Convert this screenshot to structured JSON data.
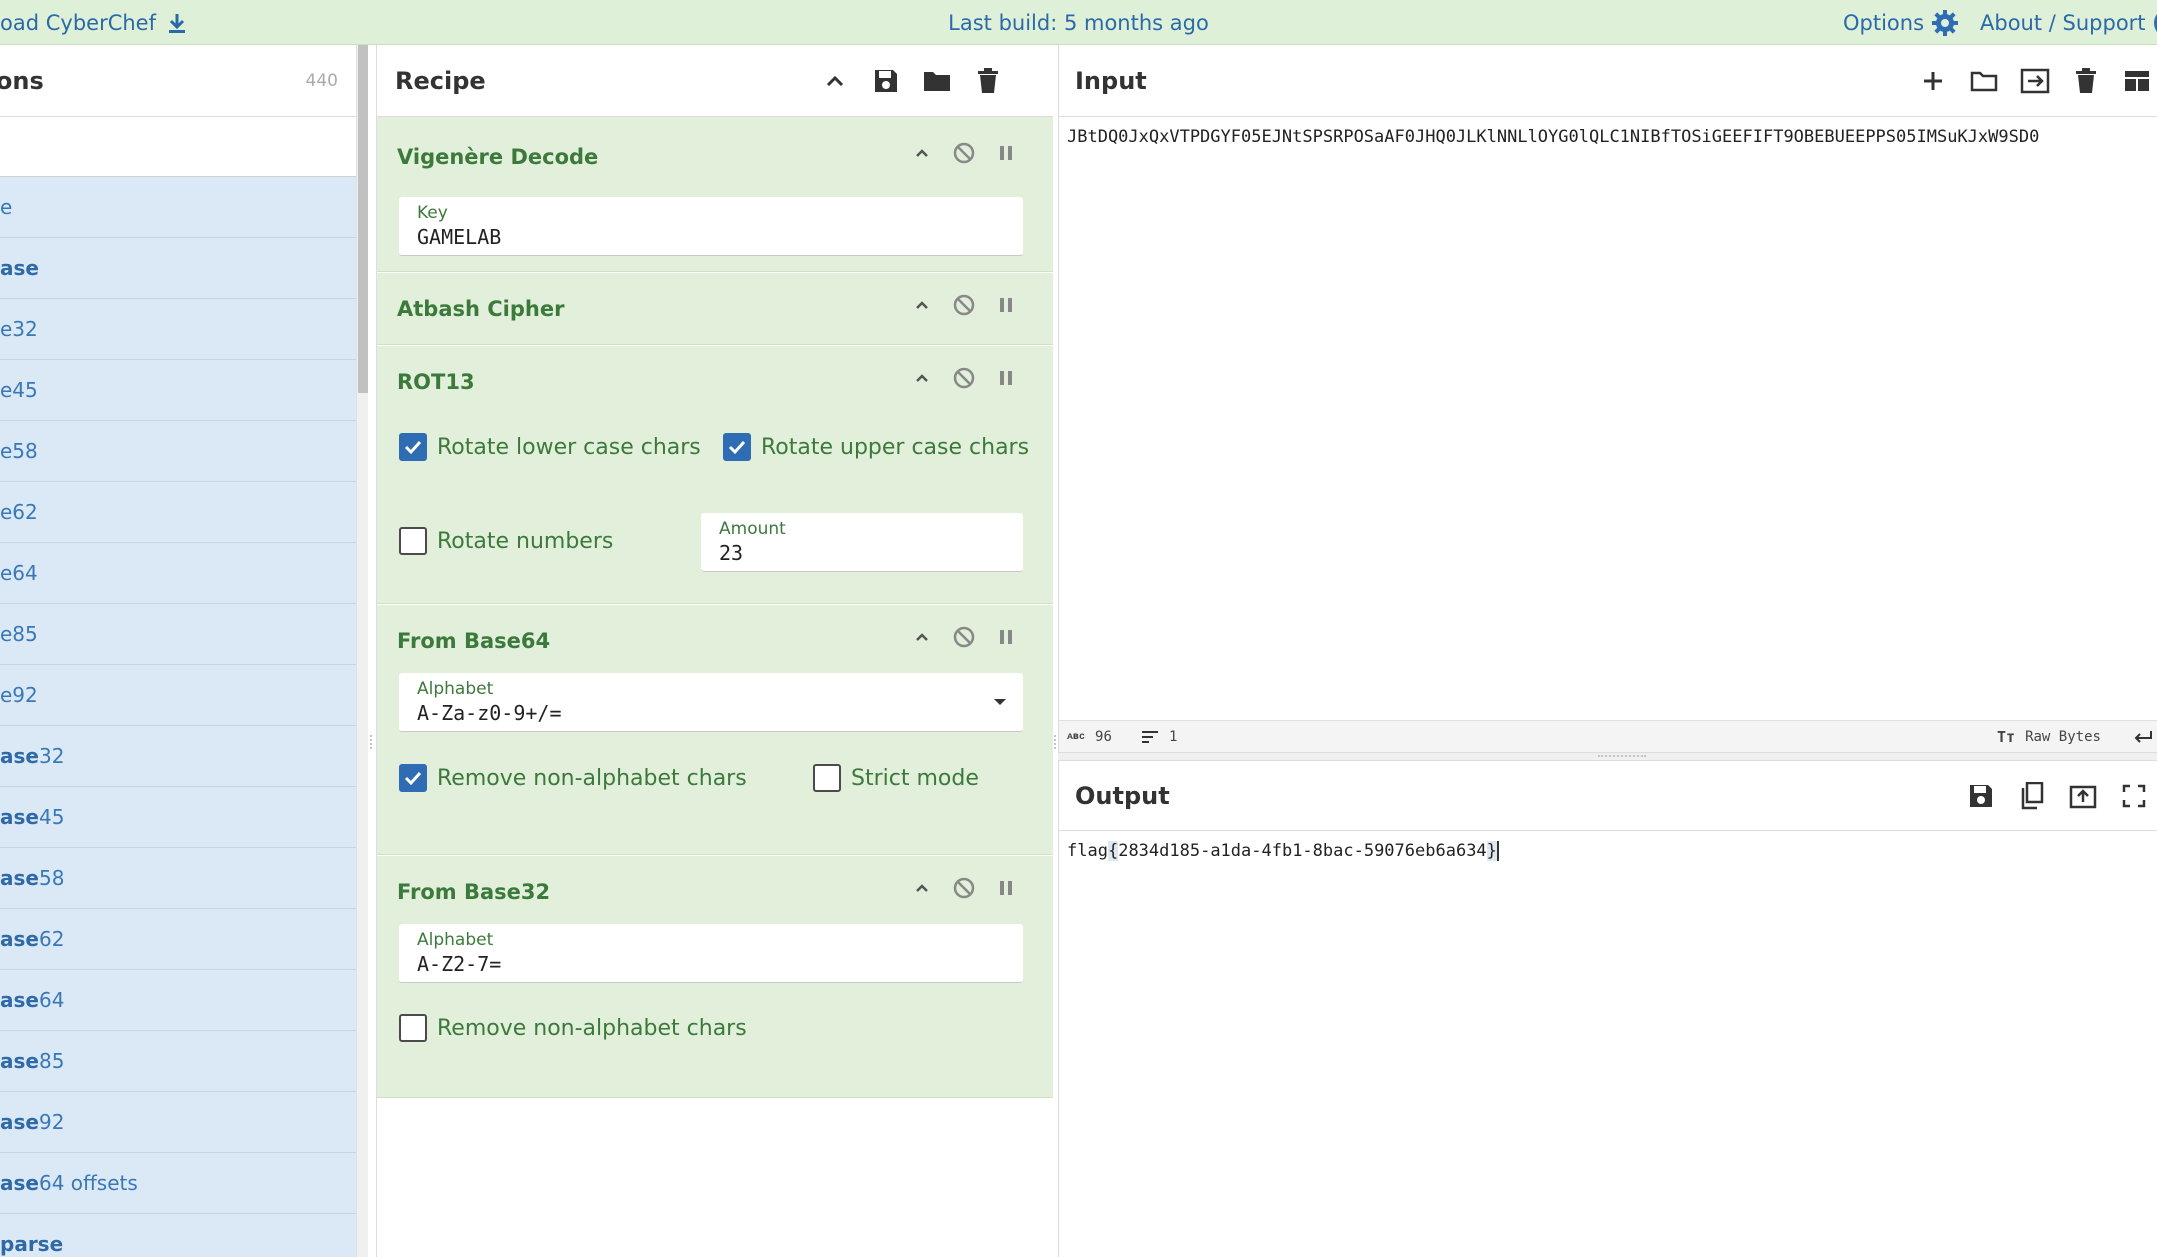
{
  "banner": {
    "download_label": "oad CyberChef",
    "build_label": "Last build: 5 months ago",
    "options_label": "Options",
    "about_label": "About / Support",
    "about_icon_glyph": "?"
  },
  "operations": {
    "title": "ations",
    "count": "440",
    "items": [
      {
        "bold": "",
        "text": "e"
      },
      {
        "bold": "ase",
        "text": ""
      },
      {
        "bold": "",
        "text": "e32"
      },
      {
        "bold": "",
        "text": "e45"
      },
      {
        "bold": "",
        "text": "e58"
      },
      {
        "bold": "",
        "text": "e62"
      },
      {
        "bold": "",
        "text": "e64"
      },
      {
        "bold": "",
        "text": "e85"
      },
      {
        "bold": "",
        "text": "e92"
      },
      {
        "bold": "ase",
        "text": "32"
      },
      {
        "bold": "ase",
        "text": "45"
      },
      {
        "bold": "ase",
        "text": "58"
      },
      {
        "bold": "ase",
        "text": "62"
      },
      {
        "bold": "ase",
        "text": "64"
      },
      {
        "bold": "ase",
        "text": "85"
      },
      {
        "bold": "ase",
        "text": "92"
      },
      {
        "bold": "ase",
        "text": "64 offsets"
      },
      {
        "bold": "parse",
        "text": ""
      }
    ]
  },
  "recipe": {
    "title": "Recipe",
    "steps": {
      "vigenere": {
        "name": "Vigenère Decode",
        "key_label": "Key",
        "key_value": "GAMELAB"
      },
      "atbash": {
        "name": "Atbash Cipher"
      },
      "rot13": {
        "name": "ROT13",
        "rotate_lower_label": "Rotate lower case chars",
        "rotate_lower_checked": true,
        "rotate_upper_label": "Rotate upper case chars",
        "rotate_upper_checked": true,
        "rotate_numbers_label": "Rotate numbers",
        "rotate_numbers_checked": false,
        "amount_label": "Amount",
        "amount_value": "23"
      },
      "base64": {
        "name": "From Base64",
        "alphabet_label": "Alphabet",
        "alphabet_value": "A-Za-z0-9+/=",
        "remove_label": "Remove non-alphabet chars",
        "remove_checked": true,
        "strict_label": "Strict mode",
        "strict_checked": false
      },
      "base32": {
        "name": "From Base32",
        "alphabet_label": "Alphabet",
        "alphabet_value": "A-Z2-7=",
        "remove_label": "Remove non-alphabet chars",
        "remove_checked": false
      }
    }
  },
  "input": {
    "title": "Input",
    "text": "JBtDQ0JxQxVTPDGYF05EJNtSPSRPOSaAF0JHQ0JLKlNNLlOYG0lQLC1NIBfTOSiGEEFIFT9OBEBUEEPPS05IMSuKJxW9SD0",
    "length": "96",
    "lines": "1",
    "encoding": "Raw Bytes"
  },
  "output": {
    "title": "Output",
    "prefix": "flag",
    "open_brace": "{",
    "body": "2834d185-a1da-4fb1-8bac-59076eb6a634",
    "close_brace": "}"
  },
  "colors": {
    "banner_bg": "#dff0d8",
    "link_blue": "#2a6aa8",
    "recipe_green": "#3c7a3c",
    "recipe_bg": "#e2efdb",
    "ops_bg": "#dbe9f6",
    "checkbox_on": "#2e6db3"
  },
  "icons": [
    "download-icon",
    "gear-icon",
    "help-icon",
    "chevron-up-icon",
    "save-icon",
    "folder-icon",
    "trash-icon",
    "disable-icon",
    "pause-icon",
    "plus-icon",
    "switch-icon",
    "layout-icon",
    "copy-icon",
    "upload-icon",
    "maximize-icon",
    "dropdown-caret-icon",
    "return-icon"
  ]
}
